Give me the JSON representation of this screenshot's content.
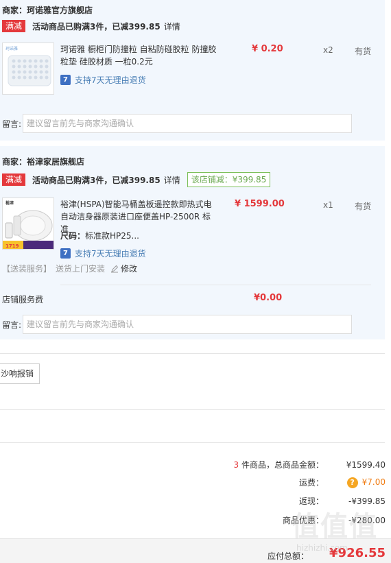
{
  "shop1": {
    "name": "商家：珂诺雅官方旗舰店",
    "promo_tag": "满减",
    "promo_text": "活动商品已购满3件，已减399.85",
    "promo_detail": "详情",
    "product": {
      "thumb_brand": "珂诺雅",
      "title": "珂诺雅 橱柜门防撞粒 自粘防碰胶粒 防撞胶粒垫 硅胶材质 一粒0.2元",
      "price": "¥ 0.20",
      "qty": "x2",
      "stock": "有货",
      "return_text": "支持7天无理由退货"
    },
    "message_label": "留言:",
    "message_placeholder": "建议留言前先与商家沟通确认"
  },
  "shop2": {
    "name": "商家：裕津家居旗舰店",
    "promo_tag": "满减",
    "promo_text": "活动商品已购满3件，已减399.85",
    "promo_detail": "详情",
    "discount_box": "该店铺减：¥399.85",
    "product": {
      "thumb_brand": "裕津",
      "thumb_badge": "1719",
      "title": "裕津(HSPA)智能马桶盖板遥控款即热式电自动洁身器原装进口座便盖HP-2500R 标准",
      "price": "¥ 1599.00",
      "qty": "x1",
      "stock": "有货",
      "size_label": "尺码：",
      "size_value": "标准款HP25...",
      "return_text": "支持7天无理由退货"
    },
    "service_label": "【送装服务】",
    "service_value": "送货上门安装",
    "edit_label": "修改",
    "fee_label": "店铺服务费",
    "fee_value": "¥0.00",
    "message_label": "留言:",
    "message_placeholder": "建议留言前先与商家沟通确认"
  },
  "invoice_button": "沙响报销",
  "summary": {
    "count": "3",
    "count_suffix": "件商品，总商品金额：",
    "total": "¥1599.40",
    "shipping_label": "运费：",
    "shipping_value": "¥7.00",
    "cashback_label": "返现：",
    "cashback_value": "-¥399.85",
    "coupon_label": "商品优惠：",
    "coupon_value": "-¥280.00",
    "pay_label": "应付总额：",
    "pay_value": "¥926.55"
  },
  "watermark": "值值值",
  "watermark_url": "hizhizhi.com",
  "colors": {
    "accent_red": "#e4393c",
    "panel_bg": "#f2f7fd",
    "green": "#6aa84f",
    "orange": "#f07b10"
  }
}
